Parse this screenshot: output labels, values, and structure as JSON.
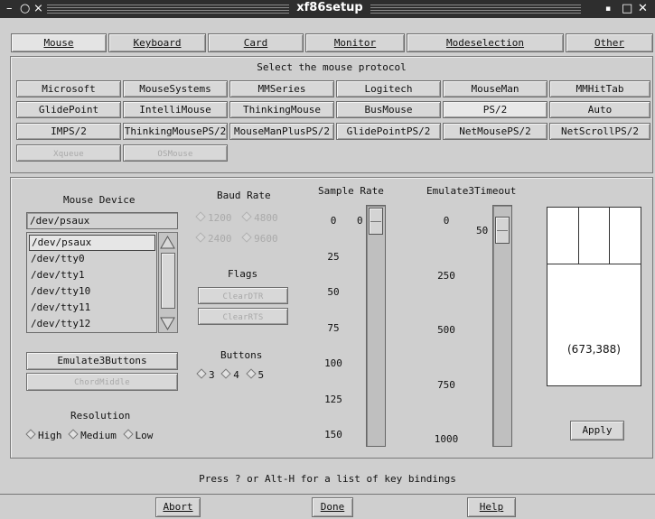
{
  "window": {
    "title": "xf86setup",
    "controls": {
      "menu": "–",
      "circle": "○",
      "close_left": "⨯",
      "iconify": "▪",
      "maximize": "□",
      "close": "✕"
    }
  },
  "tabs": [
    {
      "label": "Mouse",
      "active": true
    },
    {
      "label": "Keyboard"
    },
    {
      "label": "Card"
    },
    {
      "label": "Monitor"
    },
    {
      "label": "Modeselection"
    },
    {
      "label": "Other"
    }
  ],
  "protocol": {
    "heading": "Select the mouse protocol",
    "buttons": [
      "Microsoft",
      "MouseSystems",
      "MMSeries",
      "Logitech",
      "MouseMan",
      "MMHitTab",
      "GlidePoint",
      "IntelliMouse",
      "ThinkingMouse",
      "BusMouse",
      "PS/2",
      "Auto",
      "IMPS/2",
      "ThinkingMousePS/2",
      "MouseManPlusPS/2",
      "GlidePointPS/2",
      "NetMousePS/2",
      "NetScrollPS/2",
      "Xqueue",
      "OSMouse"
    ],
    "selected": "PS/2"
  },
  "device": {
    "label": "Mouse Device",
    "value": "/dev/psaux",
    "list": [
      "/dev/psaux",
      "/dev/tty0",
      "/dev/tty1",
      "/dev/tty10",
      "/dev/tty11",
      "/dev/tty12"
    ],
    "selected": "/dev/psaux"
  },
  "baud": {
    "label": "Baud Rate",
    "options": [
      "1200",
      "4800",
      "2400",
      "9600"
    ]
  },
  "flags": {
    "label": "Flags",
    "clear_dtr": "ClearDTR",
    "clear_rts": "ClearRTS"
  },
  "buttons_group": {
    "label": "Buttons",
    "options": [
      "3",
      "4",
      "5"
    ]
  },
  "emulate3_button": "Emulate3Buttons",
  "chord_middle_button": "ChordMiddle",
  "resolution": {
    "label": "Resolution",
    "options": [
      "High",
      "Medium",
      "Low"
    ]
  },
  "sample_rate": {
    "label": "Sample Rate",
    "value": "0",
    "ticks": [
      "0",
      "25",
      "50",
      "75",
      "100",
      "125",
      "150"
    ]
  },
  "emulate3_timeout": {
    "label": "Emulate3Timeout",
    "value": "50",
    "ticks": [
      "0",
      "250",
      "500",
      "750",
      "1000"
    ]
  },
  "mouse_coords": "(673,388)",
  "apply_label": "Apply",
  "status": "Press ? or Alt-H for a list of key bindings",
  "bottom": {
    "abort": "Abort",
    "done": "Done",
    "help": "Help"
  }
}
